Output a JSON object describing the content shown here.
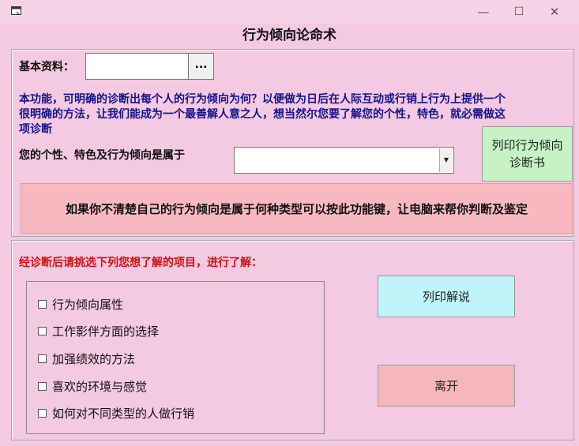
{
  "window": {
    "title": "行为倾向论命术",
    "minimize_glyph": "—",
    "maximize_glyph": "☐",
    "close_glyph": "✕"
  },
  "basic_info": {
    "label": "基本资料：",
    "value": "",
    "browse_label": "..."
  },
  "description": "本功能，可明确的诊断出每个人的行为倾向为何？以便做为日后在人际互动或行销上行为上提供一个很明确的方法，让我们能成为一个最善解人意之人，想当然尔您要了解您的个性，特色，就必需做这项诊断",
  "personality": {
    "label": "您的个性、特色及行为倾向是属于",
    "selected": ""
  },
  "buttons": {
    "print_report": "列印行为倾向诊断书",
    "print_explain": "列印解说",
    "leave": "离开"
  },
  "banner_text": "如果你不清楚自己的行为倾向是属于何种类型可以按此功能键，让电脑来帮你判断及鉴定",
  "section_head": "经诊断后请挑选下列您想了解的项目，进行了解：",
  "options": [
    {
      "label": "行为倾向属性",
      "checked": false
    },
    {
      "label": "工作影伴方面的选择",
      "checked": false
    },
    {
      "label": "加强绩效的方法",
      "checked": false
    },
    {
      "label": "喜欢的环境与感觉",
      "checked": false
    },
    {
      "label": "如何对不同类型的人做行销",
      "checked": false
    }
  ],
  "colors": {
    "background": "#f4c9e2",
    "desc_text": "#13138a",
    "section_head_text": "#d01010",
    "banner_bg": "#f7b9bf",
    "print_report_bg": "#c6f2c6",
    "print_explain_bg": "#bff5f8",
    "leave_bg": "#f6b7bc"
  }
}
